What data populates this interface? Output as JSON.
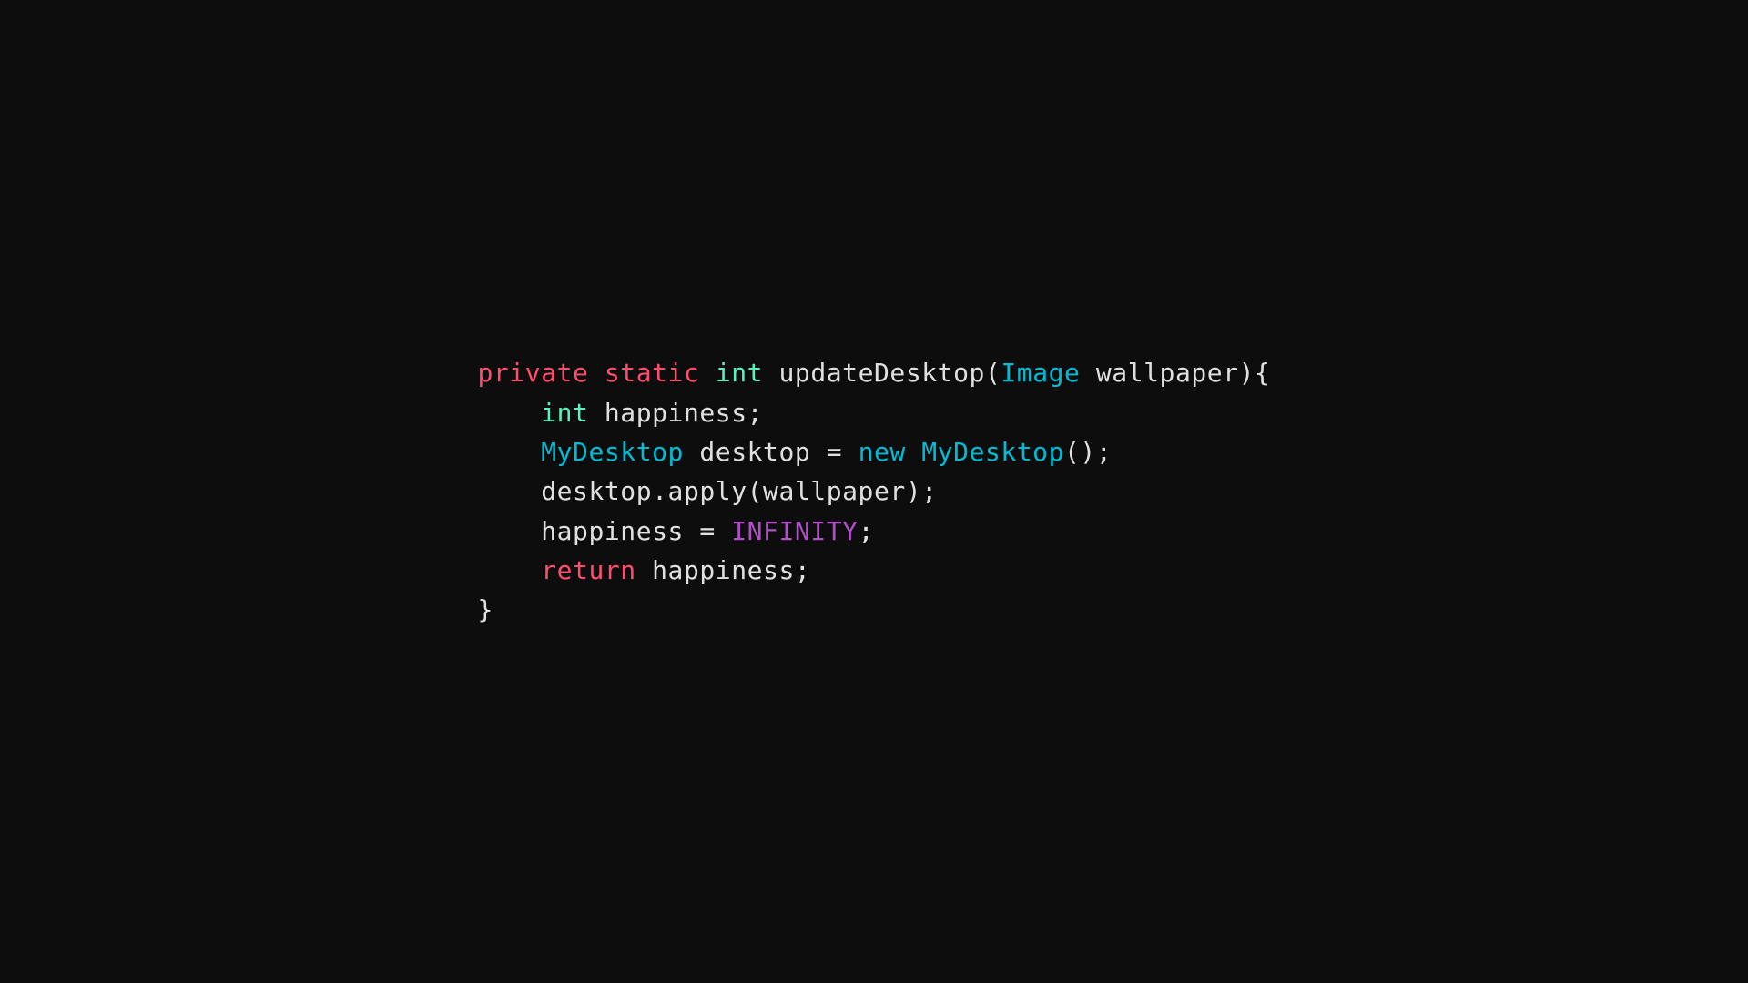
{
  "code": {
    "lines": [
      {
        "id": "line1",
        "parts": [
          {
            "text": "private",
            "class": "kw-private"
          },
          {
            "text": " ",
            "class": "plain"
          },
          {
            "text": "static",
            "class": "kw-static"
          },
          {
            "text": " ",
            "class": "plain"
          },
          {
            "text": "int",
            "class": "kw-int"
          },
          {
            "text": " updateDesktop(",
            "class": "plain"
          },
          {
            "text": "Image",
            "class": "class-name"
          },
          {
            "text": " wallpaper){",
            "class": "plain"
          }
        ]
      },
      {
        "id": "line2",
        "parts": [
          {
            "text": "    ",
            "class": "plain"
          },
          {
            "text": "int",
            "class": "kw-int"
          },
          {
            "text": " happiness;",
            "class": "plain"
          }
        ]
      },
      {
        "id": "line3",
        "parts": [
          {
            "text": "    ",
            "class": "plain"
          },
          {
            "text": "MyDesktop",
            "class": "class-name"
          },
          {
            "text": " desktop = ",
            "class": "plain"
          },
          {
            "text": "new",
            "class": "kw-new"
          },
          {
            "text": " ",
            "class": "plain"
          },
          {
            "text": "MyDesktop",
            "class": "class-name"
          },
          {
            "text": "();",
            "class": "plain"
          }
        ]
      },
      {
        "id": "line4",
        "parts": [
          {
            "text": "    desktop.apply(wallpaper);",
            "class": "plain"
          }
        ]
      },
      {
        "id": "line5",
        "parts": [
          {
            "text": "    happiness = ",
            "class": "plain"
          },
          {
            "text": "INFINITY",
            "class": "const-inf"
          },
          {
            "text": ";",
            "class": "plain"
          }
        ]
      },
      {
        "id": "line6",
        "parts": [
          {
            "text": "    ",
            "class": "plain"
          },
          {
            "text": "return",
            "class": "kw-return"
          },
          {
            "text": " happiness;",
            "class": "plain"
          }
        ]
      },
      {
        "id": "line7",
        "parts": [
          {
            "text": "}",
            "class": "plain"
          }
        ]
      }
    ]
  }
}
